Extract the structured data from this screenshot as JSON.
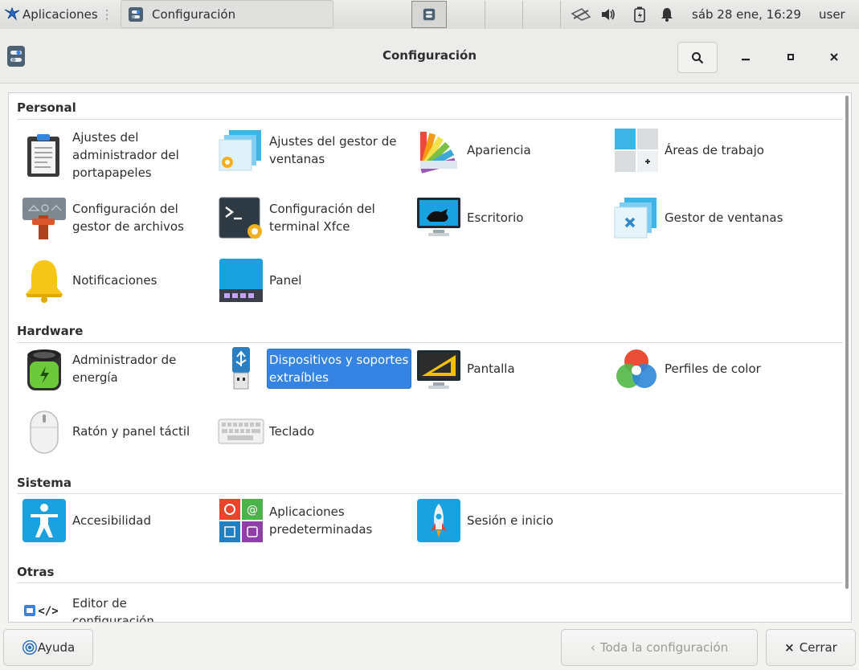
{
  "top_panel": {
    "apps_label": "Aplicaciones",
    "task_label": "Configuración",
    "clock": "sáb 28 ene, 16:29",
    "user": "user"
  },
  "window": {
    "title": "Configuración"
  },
  "categories": [
    {
      "title": "Personal",
      "items": [
        {
          "label": "Ajustes del administrador del portapapeles",
          "icon": "clipboard-icon"
        },
        {
          "label": "Ajustes del gestor de ventanas",
          "icon": "window-manager-settings-icon"
        },
        {
          "label": "Apariencia",
          "icon": "appearance-palette-icon"
        },
        {
          "label": "Áreas de trabajo",
          "icon": "workspaces-icon"
        },
        {
          "label": "Configuración del gestor de archivos",
          "icon": "file-manager-settings-icon"
        },
        {
          "label": "Configuración del terminal Xfce",
          "icon": "terminal-settings-icon"
        },
        {
          "label": "Escritorio",
          "icon": "desktop-icon"
        },
        {
          "label": "Gestor de ventanas",
          "icon": "window-manager-icon"
        },
        {
          "label": "Notificaciones",
          "icon": "bell-icon"
        },
        {
          "label": "Panel",
          "icon": "panel-icon"
        }
      ]
    },
    {
      "title": "Hardware",
      "items": [
        {
          "label": "Administrador de energía",
          "icon": "battery-icon"
        },
        {
          "label": "Dispositivos y soportes extraíbles",
          "icon": "usb-drive-icon"
        },
        {
          "label": "Pantalla",
          "icon": "display-icon"
        },
        {
          "label": "Perfiles de color",
          "icon": "color-profiles-icon"
        },
        {
          "label": "Ratón y panel táctil",
          "icon": "mouse-icon"
        },
        {
          "label": "Teclado",
          "icon": "keyboard-icon"
        }
      ]
    },
    {
      "title": "Sistema",
      "items": [
        {
          "label": "Accesibilidad",
          "icon": "accessibility-icon"
        },
        {
          "label": "Aplicaciones predeterminadas",
          "icon": "default-apps-icon"
        },
        {
          "label": "Sesión e inicio",
          "icon": "rocket-icon"
        }
      ]
    },
    {
      "title": "Otras",
      "items": [
        {
          "label": "Editor de configuración",
          "icon": "config-editor-icon"
        }
      ]
    }
  ],
  "selected_item": "Dispositivos y soportes extraíbles",
  "bottom_bar": {
    "help_label": "Ayuda",
    "all_settings_label": "Toda la configuración",
    "close_label": "Cerrar"
  },
  "colors": {
    "selection": "#3584e4",
    "window_bg": "#f3f3f2",
    "content_bg": "#ffffff"
  }
}
